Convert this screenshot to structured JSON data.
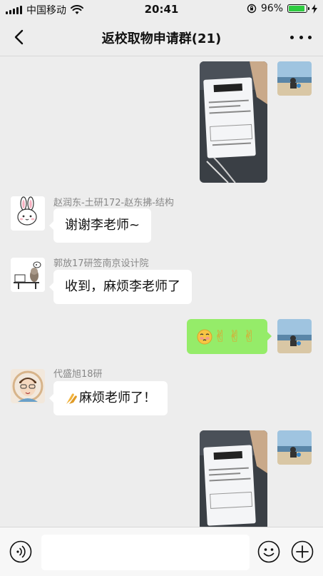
{
  "status_bar": {
    "carrier": "中国移动",
    "time": "20:41",
    "battery_percent": "96%",
    "battery_level": 0.96,
    "icons": [
      "signal-icon",
      "wifi-icon",
      "orientation-lock-icon",
      "battery-icon",
      "charging-icon"
    ]
  },
  "nav": {
    "title": "返校取物申请群(21)",
    "back_icon": "chevron-left-icon",
    "more_icon": "more-dots-icon"
  },
  "messages": [
    {
      "type": "image",
      "direction": "out",
      "content": "photo of shipping label"
    },
    {
      "type": "text",
      "direction": "in",
      "sender": "赵润东-土研172-赵东拂-结构",
      "text": "谢谢李老师~"
    },
    {
      "type": "text",
      "direction": "in",
      "sender": "郭放17研签南京设计院",
      "text": "收到，麻烦李老师了"
    },
    {
      "type": "text",
      "direction": "out",
      "text": "✌✌✌"
    },
    {
      "type": "text",
      "direction": "in",
      "sender": "代盛旭18研",
      "text": "麻烦老师了！"
    },
    {
      "type": "image",
      "direction": "out",
      "content": "photo of shipping label"
    }
  ],
  "input_bar": {
    "icons": [
      "voice-icon",
      "emoji-icon",
      "plus-icon"
    ]
  },
  "colors": {
    "background": "#ededed",
    "outgoing_bubble": "#95ec69",
    "incoming_bubble": "#ffffff",
    "battery_fill": "#2ecc40"
  }
}
